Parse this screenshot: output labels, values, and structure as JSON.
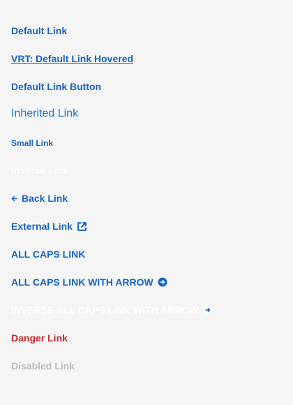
{
  "links": {
    "default": "Default Link",
    "hovered": "VRT: Default Link Hovered",
    "button": "Default Link Button",
    "inherited": "Inherited Link",
    "small": "Small Link",
    "inverse": "Inverse Link",
    "back": "Back Link",
    "external": "External Link",
    "all_caps": "ALL CAPS LINK",
    "all_caps_arrow": "ALL CAPS LINK WITH ARROW",
    "inverse_caps_arrow": "INVERSE ALL CAPS LINK WITH ARROW",
    "danger": "Danger Link",
    "disabled": "Disabled Link"
  },
  "icons": {
    "back": "arrow-left-icon",
    "external": "external-link-icon",
    "caps_arrow": "circle-arrow-right-icon",
    "inverse_caps_arrow": "circle-arrow-right-icon"
  },
  "colors": {
    "link": "#1565c0",
    "inherited": "#1976d2",
    "inverse": "#ffffff",
    "danger": "#c62828",
    "disabled": "#bdbdbd",
    "background": "#f5f5f5"
  }
}
